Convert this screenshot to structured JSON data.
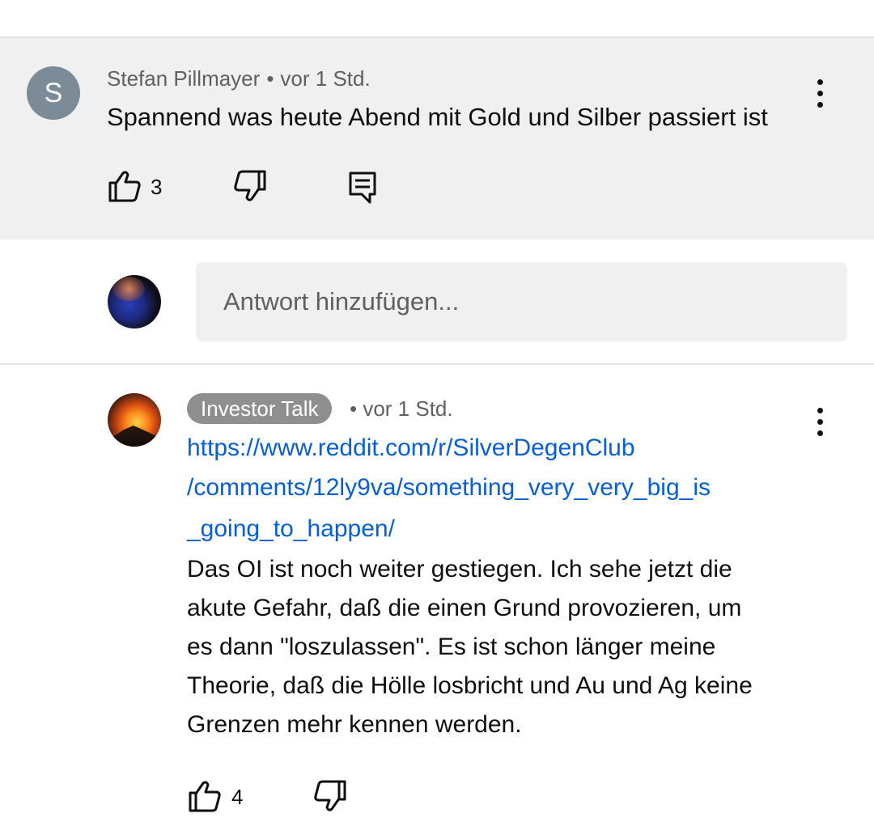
{
  "comments": [
    {
      "author": "Stefan Pillmayer",
      "separator": "•",
      "time": "vor 1 Std.",
      "avatar_letter": "S",
      "text": "Spannend was heute Abend mit Gold und Silber passiert ist",
      "likes": "3"
    },
    {
      "author": "Investor Talk",
      "separator": "•",
      "time": "vor 1 Std.",
      "link_lines": [
        "https://www.reddit.com/r/SilverDegenClub",
        "/comments/12ly9va/something_very_very_big_is",
        "_going_to_happen/"
      ],
      "body_lines": [
        "Das OI ist noch weiter gestiegen. Ich sehe jetzt die",
        "akute Gefahr, daß die einen Grund provozieren, um",
        "es dann \"loszulassen\". Es ist schon länger meine",
        "Theorie, daß die Hölle losbricht und Au und Ag keine",
        "Grenzen mehr kennen werden."
      ],
      "likes": "4"
    }
  ],
  "reply": {
    "placeholder": "Antwort hinzufügen..."
  },
  "colors": {
    "highlight_bg": "#f0f0f0",
    "meta_text": "#606060",
    "link": "#065fd4",
    "badge_bg": "#8f8f8f",
    "avatar_s_bg": "#7b8b98"
  },
  "icons": [
    "like-icon",
    "dislike-icon",
    "reply-icon",
    "more-vert-icon",
    "close-icon"
  ]
}
